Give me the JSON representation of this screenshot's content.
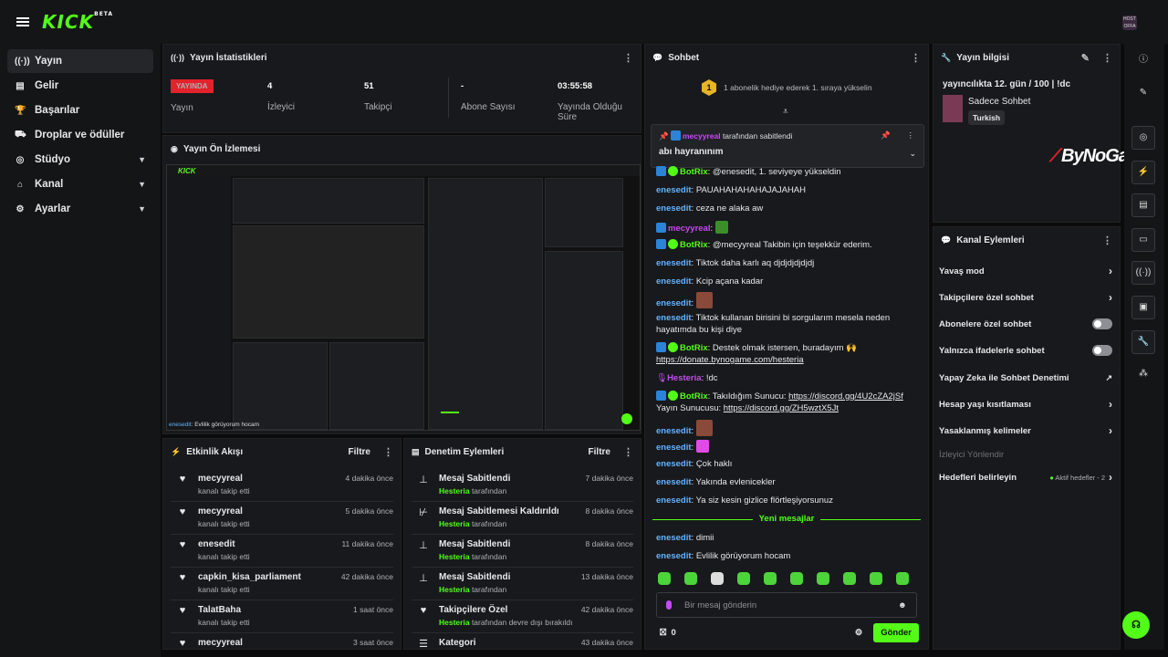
{
  "brand": {
    "logo": "KICK",
    "beta": "BETA",
    "avatar_text": "HOST OFFA"
  },
  "sidebar": {
    "items": [
      {
        "label": "Yayın",
        "icon": "((·))"
      },
      {
        "label": "Gelir",
        "icon": "▤"
      },
      {
        "label": "Başarılar",
        "icon": "🏆"
      },
      {
        "label": "Droplar ve ödüller",
        "icon": "⛟"
      },
      {
        "label": "Stüdyo",
        "icon": "◎"
      },
      {
        "label": "Kanal",
        "icon": "⌂"
      },
      {
        "label": "Ayarlar",
        "icon": "⚙"
      }
    ]
  },
  "stats": {
    "title": "Yayın İstatistikleri",
    "live_badge": "YAYINDA",
    "status_label": "Yayın",
    "viewers_value": "4",
    "viewers_label": "İzleyici",
    "followers_value": "51",
    "followers_label": "Takipçi",
    "subs_value": "-",
    "subs_label": "Abone Sayısı",
    "uptime_value": "03:55:58",
    "uptime_label": "Yayında Olduğu Süre"
  },
  "preview": {
    "title": "Yayın Ön İzlemesi",
    "footer_user": "enesedit",
    "footer_text": ": Evlilik görüyorum hocam",
    "mini_logo": "KICK"
  },
  "activity": {
    "title": "Etkinlik Akışı",
    "filter": "Filtre",
    "rows": [
      {
        "name": "mecyyreal",
        "sub": "kanalı takip etti",
        "time": "4 dakika önce"
      },
      {
        "name": "mecyyreal",
        "sub": "kanalı takip etti",
        "time": "5 dakika önce"
      },
      {
        "name": "enesedit",
        "sub": "kanalı takip etti",
        "time": "11 dakika önce"
      },
      {
        "name": "capkin_kisa_parliament",
        "sub": "kanalı takip etti",
        "time": "42 dakika önce"
      },
      {
        "name": "TalatBaha",
        "sub": "kanalı takip etti",
        "time": "1 saat önce"
      },
      {
        "name": "mecyyreal",
        "sub": "",
        "time": "3 saat önce"
      }
    ]
  },
  "moderation": {
    "title": "Denetim Eylemleri",
    "filter": "Filtre",
    "rows": [
      {
        "name": "Mesaj Sabitlendi",
        "who": "Hesteria",
        "sub": "tarafından",
        "time": "7 dakika önce",
        "icon": "pin-icon"
      },
      {
        "name": "Mesaj Sabitlemesi Kaldırıldı",
        "who": "Hesteria",
        "sub": "tarafından",
        "time": "8 dakika önce",
        "icon": "unpin-icon"
      },
      {
        "name": "Mesaj Sabitlendi",
        "who": "Hesteria",
        "sub": "tarafından",
        "time": "8 dakika önce",
        "icon": "pin-icon"
      },
      {
        "name": "Mesaj Sabitlendi",
        "who": "Hesteria",
        "sub": "tarafından",
        "time": "13 dakika önce",
        "icon": "pin-icon"
      },
      {
        "name": "Takipçilere Özel",
        "who": "Hesteria",
        "sub": "tarafından devre dışı bırakıldı",
        "time": "42 dakika önce",
        "icon": "heart-icon"
      },
      {
        "name": "Kategori",
        "who": "",
        "sub": "",
        "time": "43 dakika önce",
        "icon": "list-icon"
      }
    ]
  },
  "chat": {
    "title": "Sohbet",
    "goal_number": "1",
    "goal_text": "1 abonelik hediye ederek 1. sıraya yükselin",
    "pinned_by": "mecyyreal",
    "pinned_suffix": "tarafından sabitlendi",
    "pinned_message": "abı hayranınım",
    "messages": [
      {
        "user": "BotRix",
        "text": ": @enesedit, 1. seviyeye yükseldin"
      },
      {
        "user": "enesedit",
        "text": ": PAUAHAHAHAHAJAJAHAH"
      },
      {
        "user": "enesedit",
        "text": ": ceza ne alaka aw"
      },
      {
        "user": "mecyyreal",
        "text": ":"
      },
      {
        "user": "BotRix",
        "text": ": @mecyyreal Takibin için teşekkür ederim."
      },
      {
        "user": "enesedit",
        "text": ": Tiktok daha karlı aq djdjdjdjdjdj"
      },
      {
        "user": "enesedit",
        "text": ": Kcip açana kadar"
      },
      {
        "user": "enesedit",
        "text": ":"
      },
      {
        "user": "enesedit",
        "text": ": Tiktok kullanan birisini bi sorgularım mesela neden hayatımda bu kişi diye"
      },
      {
        "user": "BotRix",
        "text": ": Destek olmak istersen, buradayım 🙌 ",
        "link": "https://donate.bynogame.com/hesteria"
      },
      {
        "user": "Hesteria",
        "text": ": !dc"
      },
      {
        "user": "BotRix",
        "text": ": Takıldığım Sunucu: ",
        "link": "https://discord.gg/4U2cZA2jSf",
        "text2": " Yayın Sunucusu: ",
        "link2": "https://discord.gg/ZH5wztX5Jt"
      },
      {
        "user": "enesedit",
        "text": ":"
      },
      {
        "user": "enesedit",
        "text": ":"
      },
      {
        "user": "enesedit",
        "text": ": Çok haklı"
      },
      {
        "user": "enesedit",
        "text": ": Yakında evlenicekler"
      },
      {
        "user": "enesedit",
        "text": ": Ya siz kesin gizlice flörtleşiyorsunuz"
      },
      {
        "user": "enesedit",
        "text": ": dimii"
      },
      {
        "user": "enesedit",
        "text": ": Evlilik görüyorum hocam"
      }
    ],
    "new_messages": "Yeni mesajlar",
    "input_placeholder": "Bir mesaj gönderin",
    "points": "0",
    "send": "Gönder"
  },
  "stream_info": {
    "title": "Yayın bilgisi",
    "stream_title": "yayıncılıkta 12. gün / 100 | !dc",
    "category": "Sadece Sohbet",
    "language": "Turkish"
  },
  "channel_actions": {
    "title": "Kanal Eylemleri",
    "items": [
      {
        "label": "Yavaş mod",
        "control": "chevron"
      },
      {
        "label": "Takipçilere özel sohbet",
        "control": "chevron"
      },
      {
        "label": "Abonelere özel sohbet",
        "control": "toggle"
      },
      {
        "label": "Yalnızca ifadelerle sohbet",
        "control": "toggle"
      },
      {
        "label": "Yapay Zeka ile Sohbet Denetimi",
        "control": "external"
      },
      {
        "label": "Hesap yaşı kısıtlaması",
        "control": "chevron"
      },
      {
        "label": "Yasaklanmış kelimeler",
        "control": "chevron"
      },
      {
        "label": "İzleyici Yönlendir",
        "control": "none"
      },
      {
        "label": "Hedefleri belirleyin",
        "control": "chevron",
        "extra": "Aktif hedefler - 2"
      }
    ]
  },
  "watermark": "ByNoGame",
  "colors": {
    "accent": "#53fc18",
    "live": "#e3222b",
    "user_blue": "#63b3ff",
    "user_purple": "#c54bf0"
  }
}
